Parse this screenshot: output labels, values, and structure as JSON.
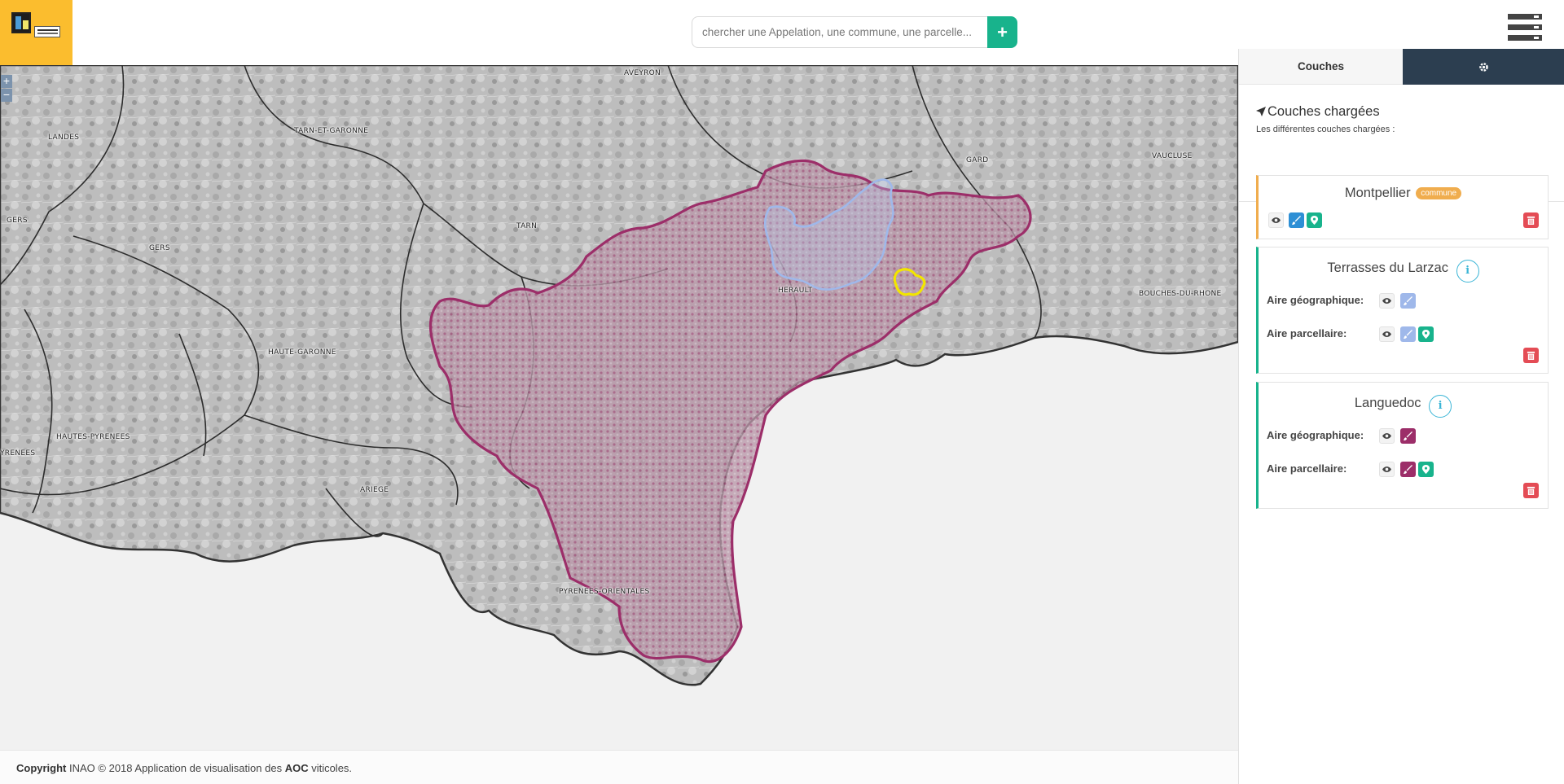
{
  "header": {
    "search_placeholder": "chercher une Appelation, une commune, une parcelle...",
    "search_button": "+",
    "logo_icon": "inao-logo",
    "menu_icon": "layers-stack-icon"
  },
  "map": {
    "zoom_in": "+",
    "zoom_out": "−",
    "departments": [
      "AVEYRON",
      "LANDES",
      "TARN-ET-GARONNE",
      "GARD",
      "VAUCLUSE",
      "GERS",
      "TARN",
      "GERS",
      "HERAULT",
      "BOUCHES-DU-RHONE",
      "HAUTE-GARONNE",
      "HAUTES-PYRENEES",
      "YRENEES",
      "ARIEGE",
      "PYRENEES-ORIENTALES"
    ],
    "colors": {
      "languedoc": "#9c2e69",
      "terrasses_du_larzac": "#9fb8ea",
      "montpellier": "#f2e600",
      "sea": "#f1f1f1"
    }
  },
  "footer": {
    "copyright": "Copyright",
    "text": " INAO © 2018 Application de visualisation des ",
    "aoc": "AOC",
    "suffix": " viticoles."
  },
  "panel": {
    "tab_layers": "Couches",
    "tab_settings_icon": "gear-icon",
    "title": "Couches chargées",
    "subtitle": "Les différentes couches chargées :",
    "layers": [
      {
        "name": "Montpellier",
        "badge": "commune",
        "accent": "#f0ad4e"
      },
      {
        "name": "Terrasses du Larzac",
        "info": "i",
        "rows": [
          "Aire géographique:",
          "Aire parcellaire:"
        ],
        "color": "#9fb8ea"
      },
      {
        "name": "Languedoc",
        "info": "i",
        "rows": [
          "Aire géographique:",
          "Aire parcellaire:"
        ],
        "color": "#9c2e69"
      }
    ]
  }
}
